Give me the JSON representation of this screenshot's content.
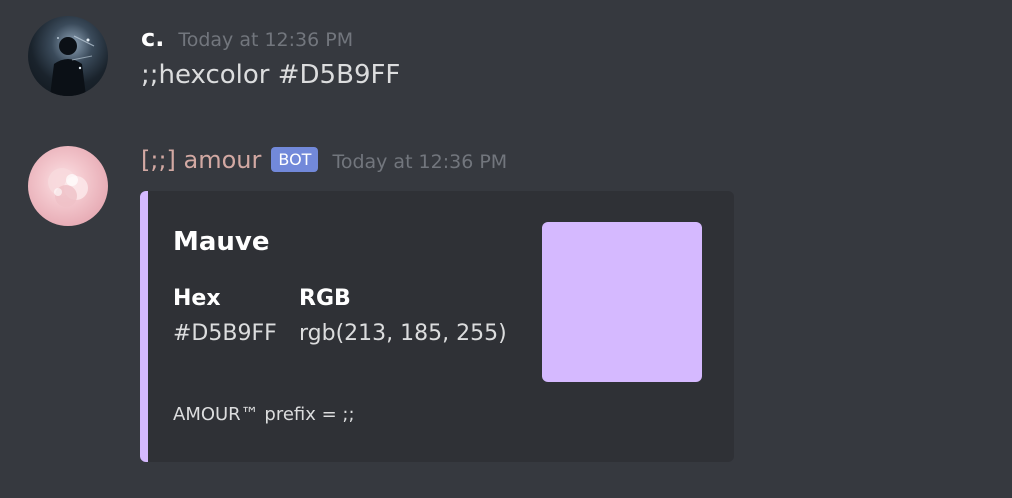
{
  "messages": [
    {
      "author": "c.",
      "timestamp": "Today at 12:36 PM",
      "content": ";;hexcolor #D5B9FF",
      "avatar_icon": "user-avatar"
    },
    {
      "author": "[;;] amour",
      "badge": "BOT",
      "timestamp": "Today at 12:36 PM",
      "avatar_icon": "bot-avatar",
      "embed": {
        "accent_color": "#d5b9ff",
        "title": "Mauve",
        "fields": [
          {
            "name": "Hex",
            "value": "#D5B9FF"
          },
          {
            "name": "RGB",
            "value": "rgb(213, 185, 255)"
          }
        ],
        "swatch_color": "#d5b9ff",
        "footer": "AMOUR™ prefix = ;;"
      }
    }
  ],
  "colors": {
    "background": "#36393f",
    "embed_background": "#2f3136",
    "bot_badge": "#7289da",
    "bot_name": "#d3a9a3",
    "timestamp": "#72767d"
  }
}
